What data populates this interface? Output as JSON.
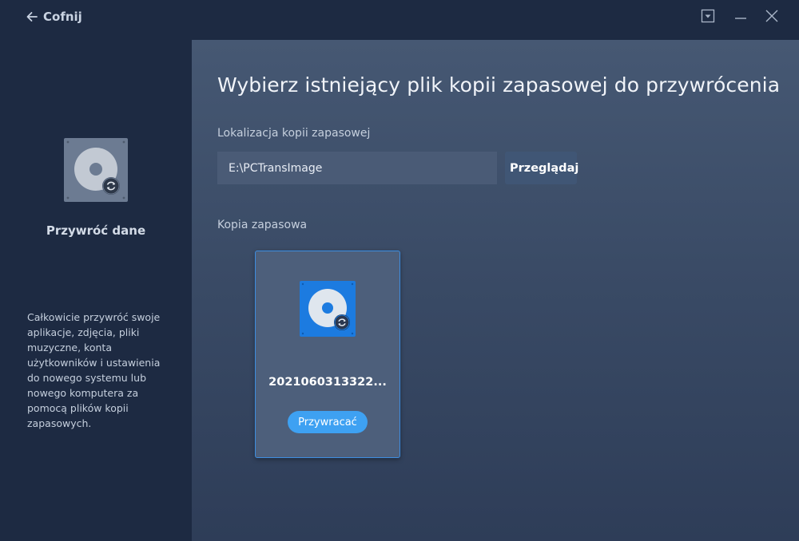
{
  "titlebar": {
    "back_label": "Cofnij",
    "icons": {
      "back": "arrow-left-icon",
      "dropdown": "dropdown-icon",
      "minimize": "minimize-icon",
      "close": "close-icon"
    }
  },
  "sidebar": {
    "icon": "disk-restore-icon",
    "title": "Przywróć dane",
    "description": "Całkowicie przywróć swoje aplikacje, zdjęcia, pliki muzyczne, konta użytkowników i ustawienia do nowego systemu lub nowego komputera za pomocą plików kopii zapasowych."
  },
  "main": {
    "heading": "Wybierz istniejący plik kopii zapasowej do przywrócenia",
    "location": {
      "label": "Lokalizacja kopii zapasowej",
      "value": "E:\\PCTransImage",
      "browse_label": "Przeglądaj"
    },
    "backup": {
      "label": "Kopia zapasowa",
      "items": [
        {
          "name": "2021060313322...",
          "icon": "disk-restore-icon",
          "restore_label": "Przywracać"
        }
      ]
    }
  },
  "colors": {
    "sidebar_bg": "#1d2a42",
    "main_bg": "#3a4b66",
    "card_border": "#3d8de0",
    "card_icon_bg": "#1c7be0",
    "restore_button": "#3ea1f2"
  }
}
